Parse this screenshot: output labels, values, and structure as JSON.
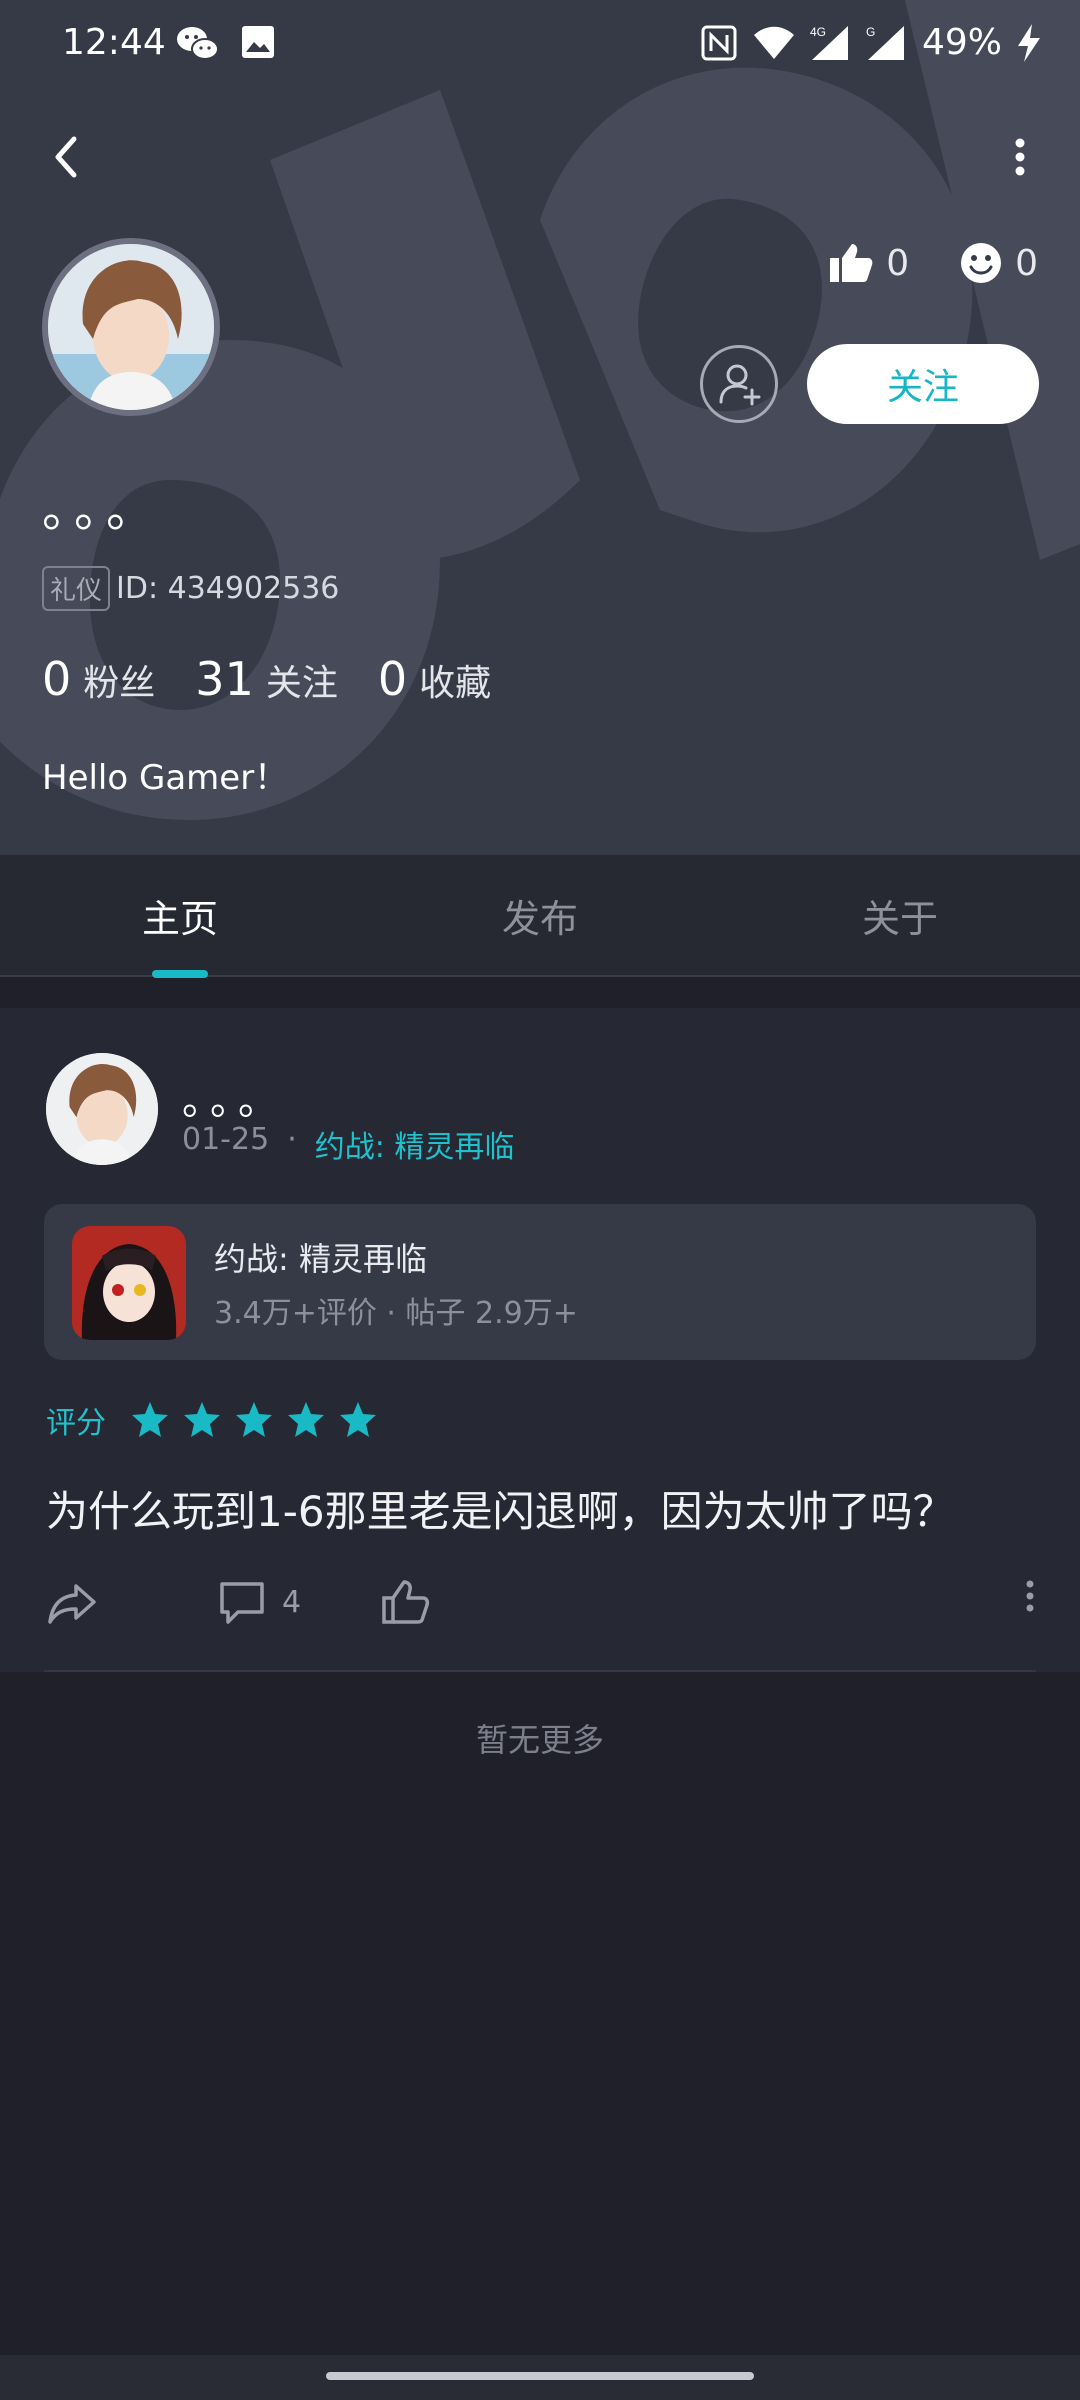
{
  "status_bar": {
    "time": "12:44",
    "battery": "49%"
  },
  "profile": {
    "likes": "0",
    "smiles": "0",
    "follow_label": "关注",
    "username": "。。。",
    "id_tag": "礼仪",
    "id_text": "ID: 434902536",
    "stats": [
      {
        "num": "0",
        "label": "粉丝"
      },
      {
        "num": "31",
        "label": "关注"
      },
      {
        "num": "0",
        "label": "收藏"
      }
    ],
    "bio": "Hello Gamer！"
  },
  "tabs": [
    {
      "label": "主页"
    },
    {
      "label": "发布"
    },
    {
      "label": "关于"
    }
  ],
  "post": {
    "username": "。。。",
    "date": "01-25",
    "separator": "·",
    "game_link": "约战: 精灵再临",
    "game_card": {
      "title": "约战: 精灵再临",
      "subtitle": "3.4万+评价  ·  帖子 2.9万+"
    },
    "rating_label": "评分",
    "rating": 5,
    "rating_max": 5,
    "text": "为什么玩到1-6那里老是闪退啊，因为太帅了吗？",
    "comment_count": "4"
  },
  "footer": {
    "no_more": "暂无更多"
  },
  "colors": {
    "accent": "#19b9c6",
    "header_bg": "#363946",
    "page_bg": "#1f2029"
  }
}
